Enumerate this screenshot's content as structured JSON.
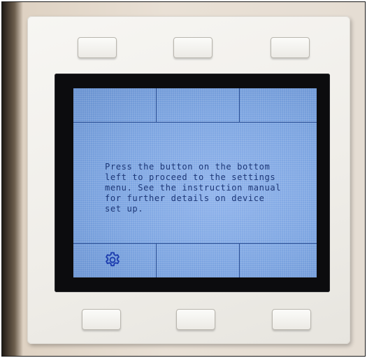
{
  "screen": {
    "message_lines": [
      "Press the button on the bottom",
      "left to proceed to the settings",
      "menu. See the instruction manual",
      "for further details on device",
      "set up."
    ],
    "softkeys": [
      {
        "icon": "gear-icon"
      },
      {
        "icon": ""
      },
      {
        "icon": ""
      }
    ]
  },
  "colors": {
    "lcd_background": "#7aa3e0",
    "lcd_text": "#1c3676",
    "bezel": "#0c0c0e",
    "plate": "#efede8"
  }
}
